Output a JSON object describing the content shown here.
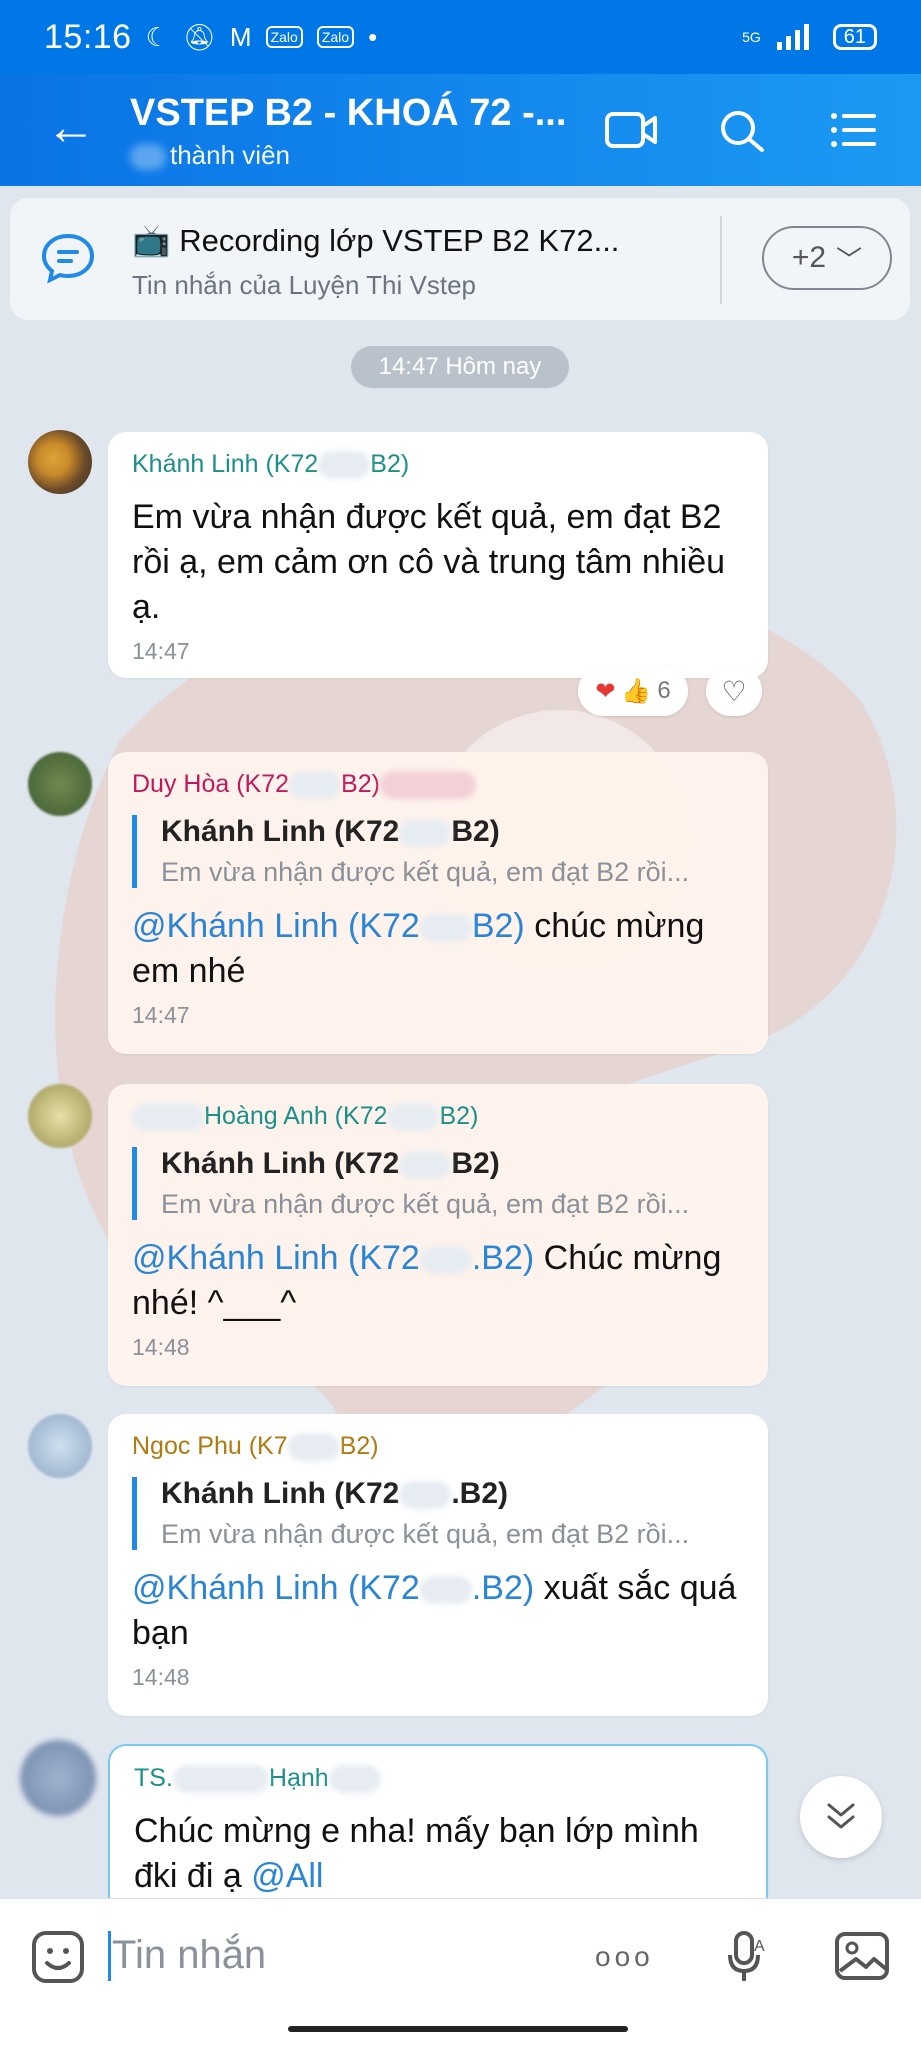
{
  "status": {
    "time": "15:16",
    "icons": [
      "moon-icon",
      "mute-icon",
      "gmail-icon",
      "zalo-icon",
      "zalo-icon",
      "dot-icon"
    ],
    "network": "5G",
    "battery": "61"
  },
  "header": {
    "title": "VSTEP B2 - KHOÁ 72 -...",
    "subtitle": "thành viên"
  },
  "pinned": {
    "title": "📺 Recording lớp VSTEP B2 K72...",
    "subtitle": "Tin nhắn của Luyện Thi Vstep",
    "more": "+2"
  },
  "date_pill": "14:47 Hôm nay",
  "messages": [
    {
      "sender_a": "Khánh Linh (K72",
      "sender_b": "B2)",
      "text": "Em vừa nhận được kết quả, em đạt B2 rồi ạ, em cảm ơn cô và trung tâm nhiều ạ.",
      "time": "14:47",
      "reaction_count": "6"
    },
    {
      "sender_a": "Duy Hòa (K72",
      "sender_b": "B2)",
      "quote_name_a": "Khánh Linh (K72",
      "quote_name_b": "B2)",
      "quote_text": "Em vừa nhận được kết quả, em đạt B2 rồi...",
      "mention_a": "@Khánh Linh (K72",
      "mention_b": "B2)",
      "text": " chúc mừng em nhé",
      "time": "14:47"
    },
    {
      "sender_a": "Hoàng Anh (K72",
      "sender_b": "B2)",
      "quote_name_a": "Khánh Linh (K72",
      "quote_name_b": "B2)",
      "quote_text": "Em vừa nhận được kết quả, em đạt B2 rồi...",
      "mention_a": "@Khánh Linh (K72",
      "mention_b": ".B2)",
      "text": " Chúc mừng nhé! ^___^",
      "time": "14:48"
    },
    {
      "sender_a": "Ngoc Phu (K7",
      "sender_b": "B2)",
      "quote_name_a": "Khánh Linh (K72",
      "quote_name_b": ".B2)",
      "quote_text": "Em vừa nhận được kết quả, em đạt B2 rồi...",
      "mention_a": "@Khánh Linh (K72",
      "mention_b": ".B2)",
      "text": "  xuất sắc quá bạn",
      "time": "14:48"
    },
    {
      "sender_a": "TS.",
      "sender_b": "Hạnh",
      "text": "Chúc mừng e nha! mấy bạn lớp mình đki đi ạ ",
      "mention": "@All"
    }
  ],
  "composer": {
    "placeholder": "Tin nhắn",
    "more": "ooo"
  },
  "colors": {
    "header": "#0a73e6",
    "sender_teal": "#1b8f8a",
    "sender_pink": "#c2185b",
    "sender_gold": "#b07a10",
    "mention": "#2a85d6"
  }
}
